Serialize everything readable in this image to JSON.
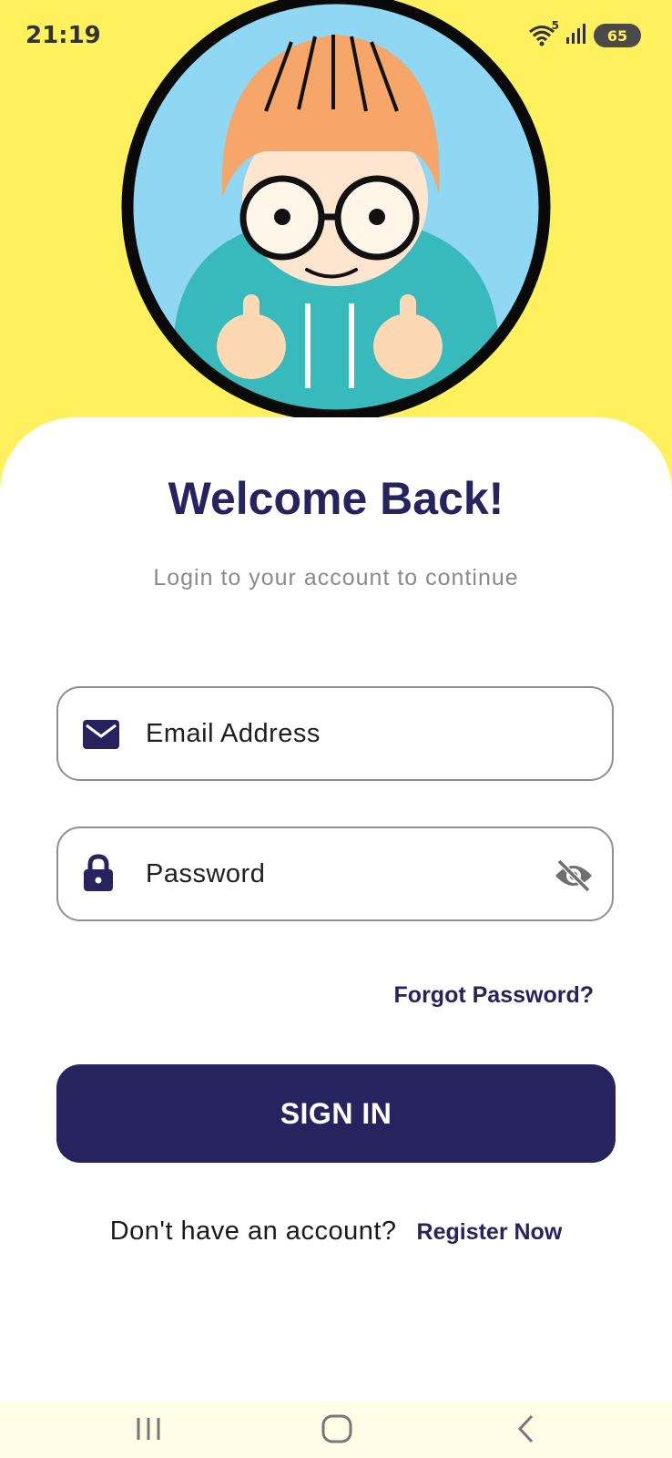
{
  "status_bar": {
    "time": "21:19",
    "wifi_label": "5",
    "battery": "65",
    "icons": [
      "wifi-icon",
      "signal-icon",
      "battery-icon"
    ]
  },
  "header": {
    "background_color": "#FFF05E",
    "illustration": "avatar-illustration"
  },
  "login": {
    "title": "Welcome Back!",
    "subtitle": "Login to your account to continue",
    "email": {
      "placeholder": "Email Address",
      "value": "",
      "icon": "mail-icon"
    },
    "password": {
      "placeholder": "Password",
      "value": "",
      "icon": "lock-icon",
      "toggle_icon": "eye-off-icon"
    },
    "forgot_label": "Forgot Password?",
    "signin_label": "SIGN IN",
    "register_prompt": "Don't have an account?",
    "register_label": "Register Now"
  },
  "colors": {
    "primary": "#26235E",
    "accent_yellow": "#FFF05E",
    "text_muted": "#8a8a8a"
  },
  "nav_bar": {
    "buttons": [
      "recents-icon",
      "home-icon",
      "back-icon"
    ]
  }
}
